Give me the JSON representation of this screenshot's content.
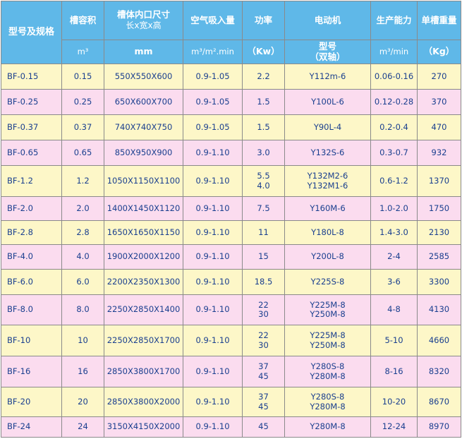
{
  "header": {
    "model": "型号及规格",
    "volume": "槽容积",
    "volume_unit": "m³",
    "size": "槽体内口尺寸",
    "size_sub": "长x宽x高",
    "size_unit": "mm",
    "air": "空气吸入量",
    "air_unit": "m³/m².min",
    "power": "功率",
    "power_unit": "（Kw）",
    "motor": "电动机",
    "motor_sub": "型号\n（双轴）",
    "capacity": "生产能力",
    "capacity_unit": "m³/min",
    "weight": "单槽重量",
    "weight_unit": "（Kg）"
  },
  "rows": [
    {
      "model": "BF-0.15",
      "volume": "0.15",
      "size": "550X550X600",
      "air": "0.9-1.05",
      "power": "2.2",
      "motor": "Y112m-6",
      "capacity": "0.06-0.16",
      "weight": "270"
    },
    {
      "model": "BF-0.25",
      "volume": "0.25",
      "size": "650X600X700",
      "air": "0.9-1.05",
      "power": "1.5",
      "motor": "Y100L-6",
      "capacity": "0.12-0.28",
      "weight": "370"
    },
    {
      "model": "BF-0.37",
      "volume": "0.37",
      "size": "740X740X750",
      "air": "0.9-1.05",
      "power": "1.5",
      "motor": "Y90L-4",
      "capacity": "0.2-0.4",
      "weight": "470"
    },
    {
      "model": "BF-0.65",
      "volume": "0.65",
      "size": "850X950X900",
      "air": "0.9-1.10",
      "power": "3.0",
      "motor": "Y132S-6",
      "capacity": "0.3-0.7",
      "weight": "932"
    },
    {
      "model": "BF-1.2",
      "volume": "1.2",
      "size": "1050X1150X1100",
      "air": "0.9-1.10",
      "power": "5.5\n4.0",
      "motor": "Y132M2-6\nY132M1-6",
      "capacity": "0.6-1.2",
      "weight": "1370"
    },
    {
      "model": "BF-2.0",
      "volume": "2.0",
      "size": "1400X1450X1120",
      "air": "0.9-1.10",
      "power": "7.5",
      "motor": "Y160M-6",
      "capacity": "1.0-2.0",
      "weight": "1750"
    },
    {
      "model": "BF-2.8",
      "volume": "2.8",
      "size": "1650X1650X1150",
      "air": "0.9-1.10",
      "power": "11",
      "motor": "Y180L-8",
      "capacity": "1.4-3.0",
      "weight": "2130"
    },
    {
      "model": "BF-4.0",
      "volume": "4.0",
      "size": "1900X2000X1200",
      "air": "0.9-1.10",
      "power": "15",
      "motor": "Y200L-8",
      "capacity": "2-4",
      "weight": "2585"
    },
    {
      "model": "BF-6.0",
      "volume": "6.0",
      "size": "2200X2350X1300",
      "air": "0.9-1.10",
      "power": "18.5",
      "motor": "Y225S-8",
      "capacity": "3-6",
      "weight": "3300"
    },
    {
      "model": "BF-8.0",
      "volume": "8.0",
      "size": "2250X2850X1400",
      "air": "0.9-1.10",
      "power": "22\n30",
      "motor": "Y225M-8\nY250M-8",
      "capacity": "4-8",
      "weight": "4130"
    },
    {
      "model": "BF-10",
      "volume": "10",
      "size": "2250X2850X1700",
      "air": "0.9-1.10",
      "power": "22\n30",
      "motor": "Y225M-8\nY250M-8",
      "capacity": "5-10",
      "weight": "4660"
    },
    {
      "model": "BF-16",
      "volume": "16",
      "size": "2850X3800X1700",
      "air": "0.9-1.10",
      "power": "37\n45",
      "motor": "Y280S-8\nY280M-8",
      "capacity": "8-16",
      "weight": "8320"
    },
    {
      "model": "BF-20",
      "volume": "20",
      "size": "2850X3800X2000",
      "air": "0.9-1.10",
      "power": "37\n45",
      "motor": "Y280S-8\nY280M-8",
      "capacity": "10-20",
      "weight": "8670"
    },
    {
      "model": "BF-24",
      "volume": "24",
      "size": "3150X4150X2000",
      "air": "0.9-1.10",
      "power": "45",
      "motor": "Y280M-8",
      "capacity": "12-24",
      "weight": "8970"
    }
  ]
}
